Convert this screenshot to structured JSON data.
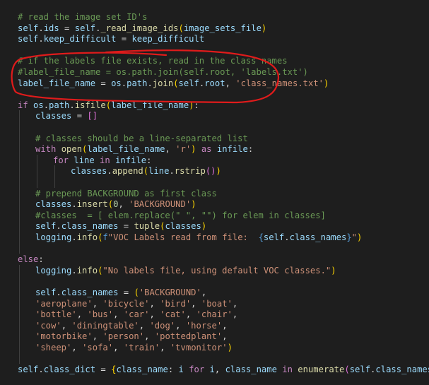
{
  "colors": {
    "background": "#1e1e1e",
    "annotation": "#e01b1b"
  },
  "editor": {
    "lines": [
      {
        "id": "l01",
        "indent": 0,
        "tokens": [
          [
            "com",
            "# read the image set ID's"
          ]
        ]
      },
      {
        "id": "l02",
        "indent": 0,
        "tokens": [
          [
            "var",
            "self"
          ],
          [
            "op",
            "."
          ],
          [
            "var",
            "ids"
          ],
          [
            "op",
            " = "
          ],
          [
            "var",
            "self"
          ],
          [
            "op",
            "."
          ],
          [
            "fn",
            "_read_image_ids"
          ],
          [
            "br",
            "("
          ],
          [
            "var",
            "image_sets_file"
          ],
          [
            "br",
            ")"
          ]
        ]
      },
      {
        "id": "l03",
        "indent": 0,
        "tokens": [
          [
            "var",
            "self"
          ],
          [
            "op",
            "."
          ],
          [
            "var",
            "keep_difficult"
          ],
          [
            "op",
            " = "
          ],
          [
            "var",
            "keep_difficult"
          ]
        ]
      },
      {
        "id": "l04",
        "indent": 0,
        "tokens": []
      },
      {
        "id": "l05",
        "indent": 0,
        "tokens": [
          [
            "com",
            "# if the labels file exists, read in the class names"
          ]
        ]
      },
      {
        "id": "l06",
        "indent": 0,
        "tokens": [
          [
            "com",
            "#label_file_name = os.path.join(self.root, 'labels.txt')"
          ]
        ]
      },
      {
        "id": "l07",
        "indent": 0,
        "tokens": [
          [
            "var",
            "label_file_name"
          ],
          [
            "op",
            " = "
          ],
          [
            "var",
            "os"
          ],
          [
            "op",
            "."
          ],
          [
            "var",
            "path"
          ],
          [
            "op",
            "."
          ],
          [
            "fn",
            "join"
          ],
          [
            "br",
            "("
          ],
          [
            "var",
            "self"
          ],
          [
            "op",
            "."
          ],
          [
            "var",
            "root"
          ],
          [
            "op",
            ", "
          ],
          [
            "str",
            "'class_names.txt'"
          ],
          [
            "br",
            ")"
          ]
        ]
      },
      {
        "id": "l08",
        "indent": 0,
        "tokens": []
      },
      {
        "id": "l09",
        "indent": 0,
        "tokens": [
          [
            "kw",
            "if "
          ],
          [
            "var",
            "os"
          ],
          [
            "op",
            "."
          ],
          [
            "var",
            "path"
          ],
          [
            "op",
            "."
          ],
          [
            "fn",
            "isfile"
          ],
          [
            "br",
            "("
          ],
          [
            "var",
            "label_file_name"
          ],
          [
            "br",
            ")"
          ],
          [
            "op",
            ":"
          ]
        ]
      },
      {
        "id": "l10",
        "indent": 1,
        "tokens": [
          [
            "var",
            "classes"
          ],
          [
            "op",
            " = "
          ],
          [
            "br2",
            "[]"
          ]
        ]
      },
      {
        "id": "l11",
        "indent": 1,
        "tokens": []
      },
      {
        "id": "l12",
        "indent": 1,
        "tokens": [
          [
            "com",
            "# classes should be a line-separated list"
          ]
        ]
      },
      {
        "id": "l13",
        "indent": 1,
        "tokens": [
          [
            "kw",
            "with "
          ],
          [
            "fn",
            "open"
          ],
          [
            "br",
            "("
          ],
          [
            "var",
            "label_file_name"
          ],
          [
            "op",
            ", "
          ],
          [
            "str",
            "'r'"
          ],
          [
            "br",
            ")"
          ],
          [
            "kw",
            " as "
          ],
          [
            "var",
            "infile"
          ],
          [
            "op",
            ":"
          ]
        ]
      },
      {
        "id": "l14",
        "indent": 2,
        "tokens": [
          [
            "kw",
            "for "
          ],
          [
            "var",
            "line"
          ],
          [
            "kw",
            " in "
          ],
          [
            "var",
            "infile"
          ],
          [
            "op",
            ":"
          ]
        ]
      },
      {
        "id": "l15",
        "indent": 3,
        "tokens": [
          [
            "var",
            "classes"
          ],
          [
            "op",
            "."
          ],
          [
            "fn",
            "append"
          ],
          [
            "br",
            "("
          ],
          [
            "var",
            "line"
          ],
          [
            "op",
            "."
          ],
          [
            "fn",
            "rstrip"
          ],
          [
            "br2",
            "()"
          ],
          [
            "br",
            ")"
          ]
        ]
      },
      {
        "id": "l16",
        "indent": 1,
        "tokens": []
      },
      {
        "id": "l17",
        "indent": 1,
        "tokens": [
          [
            "com",
            "# prepend BACKGROUND as first class"
          ]
        ]
      },
      {
        "id": "l18",
        "indent": 1,
        "tokens": [
          [
            "var",
            "classes"
          ],
          [
            "op",
            "."
          ],
          [
            "fn",
            "insert"
          ],
          [
            "br",
            "("
          ],
          [
            "num",
            "0"
          ],
          [
            "op",
            ", "
          ],
          [
            "str",
            "'BACKGROUND'"
          ],
          [
            "br",
            ")"
          ]
        ]
      },
      {
        "id": "l19",
        "indent": 1,
        "tokens": [
          [
            "com",
            "#classes  = [ elem.replace(\" \", \"\") for elem in classes]"
          ]
        ]
      },
      {
        "id": "l20",
        "indent": 1,
        "tokens": [
          [
            "var",
            "self"
          ],
          [
            "op",
            "."
          ],
          [
            "var",
            "class_names"
          ],
          [
            "op",
            " = "
          ],
          [
            "fn",
            "tuple"
          ],
          [
            "br",
            "("
          ],
          [
            "var",
            "classes"
          ],
          [
            "br",
            ")"
          ]
        ]
      },
      {
        "id": "l21",
        "indent": 1,
        "tokens": [
          [
            "var",
            "logging"
          ],
          [
            "op",
            "."
          ],
          [
            "fn",
            "info"
          ],
          [
            "br",
            "("
          ],
          [
            "kw2",
            "f"
          ],
          [
            "str",
            "\"VOC Labels read from file:  "
          ],
          [
            "kw2",
            "{"
          ],
          [
            "var",
            "self"
          ],
          [
            "op",
            "."
          ],
          [
            "var",
            "class_names"
          ],
          [
            "kw2",
            "}"
          ],
          [
            "str",
            "\""
          ],
          [
            "br",
            ")"
          ]
        ]
      },
      {
        "id": "l22",
        "indent": 0,
        "tokens": []
      },
      {
        "id": "l23",
        "indent": 0,
        "tokens": [
          [
            "kw",
            "else"
          ],
          [
            "op",
            ":"
          ]
        ]
      },
      {
        "id": "l24",
        "indent": 1,
        "tokens": [
          [
            "var",
            "logging"
          ],
          [
            "op",
            "."
          ],
          [
            "fn",
            "info"
          ],
          [
            "br",
            "("
          ],
          [
            "str",
            "\"No labels file, using default VOC classes.\""
          ],
          [
            "br",
            ")"
          ]
        ]
      },
      {
        "id": "l25",
        "indent": 1,
        "tokens": []
      },
      {
        "id": "l26",
        "indent": 1,
        "tokens": [
          [
            "var",
            "self"
          ],
          [
            "op",
            "."
          ],
          [
            "var",
            "class_names"
          ],
          [
            "op",
            " = "
          ],
          [
            "br",
            "("
          ],
          [
            "str",
            "'BACKGROUND'"
          ],
          [
            "op",
            ","
          ]
        ]
      },
      {
        "id": "l27",
        "indent": 1,
        "tokens": [
          [
            "str",
            "'aeroplane'"
          ],
          [
            "op",
            ", "
          ],
          [
            "str",
            "'bicycle'"
          ],
          [
            "op",
            ", "
          ],
          [
            "str",
            "'bird'"
          ],
          [
            "op",
            ", "
          ],
          [
            "str",
            "'boat'"
          ],
          [
            "op",
            ","
          ]
        ]
      },
      {
        "id": "l28",
        "indent": 1,
        "tokens": [
          [
            "str",
            "'bottle'"
          ],
          [
            "op",
            ", "
          ],
          [
            "str",
            "'bus'"
          ],
          [
            "op",
            ", "
          ],
          [
            "str",
            "'car'"
          ],
          [
            "op",
            ", "
          ],
          [
            "str",
            "'cat'"
          ],
          [
            "op",
            ", "
          ],
          [
            "str",
            "'chair'"
          ],
          [
            "op",
            ","
          ]
        ]
      },
      {
        "id": "l29",
        "indent": 1,
        "tokens": [
          [
            "str",
            "'cow'"
          ],
          [
            "op",
            ", "
          ],
          [
            "str",
            "'diningtable'"
          ],
          [
            "op",
            ", "
          ],
          [
            "str",
            "'dog'"
          ],
          [
            "op",
            ", "
          ],
          [
            "str",
            "'horse'"
          ],
          [
            "op",
            ","
          ]
        ]
      },
      {
        "id": "l30",
        "indent": 1,
        "tokens": [
          [
            "str",
            "'motorbike'"
          ],
          [
            "op",
            ", "
          ],
          [
            "str",
            "'person'"
          ],
          [
            "op",
            ", "
          ],
          [
            "str",
            "'pottedplant'"
          ],
          [
            "op",
            ","
          ]
        ]
      },
      {
        "id": "l31",
        "indent": 1,
        "tokens": [
          [
            "str",
            "'sheep'"
          ],
          [
            "op",
            ", "
          ],
          [
            "str",
            "'sofa'"
          ],
          [
            "op",
            ", "
          ],
          [
            "str",
            "'train'"
          ],
          [
            "op",
            ", "
          ],
          [
            "str",
            "'tvmonitor'"
          ],
          [
            "br",
            ")"
          ]
        ]
      },
      {
        "id": "l32",
        "indent": 0,
        "tokens": []
      },
      {
        "id": "l33",
        "indent": 0,
        "tokens": [
          [
            "var",
            "self"
          ],
          [
            "op",
            "."
          ],
          [
            "var",
            "class_dict"
          ],
          [
            "op",
            " = "
          ],
          [
            "br",
            "{"
          ],
          [
            "var",
            "class_name"
          ],
          [
            "op",
            ": "
          ],
          [
            "var",
            "i"
          ],
          [
            "kw",
            " for "
          ],
          [
            "var",
            "i"
          ],
          [
            "op",
            ", "
          ],
          [
            "var",
            "class_name"
          ],
          [
            "kw",
            " in "
          ],
          [
            "fn",
            "enumerate"
          ],
          [
            "br2",
            "("
          ],
          [
            "var",
            "self"
          ],
          [
            "op",
            "."
          ],
          [
            "var",
            "class_names"
          ],
          [
            "br2",
            ")"
          ],
          [
            "br",
            "}"
          ]
        ]
      }
    ]
  }
}
